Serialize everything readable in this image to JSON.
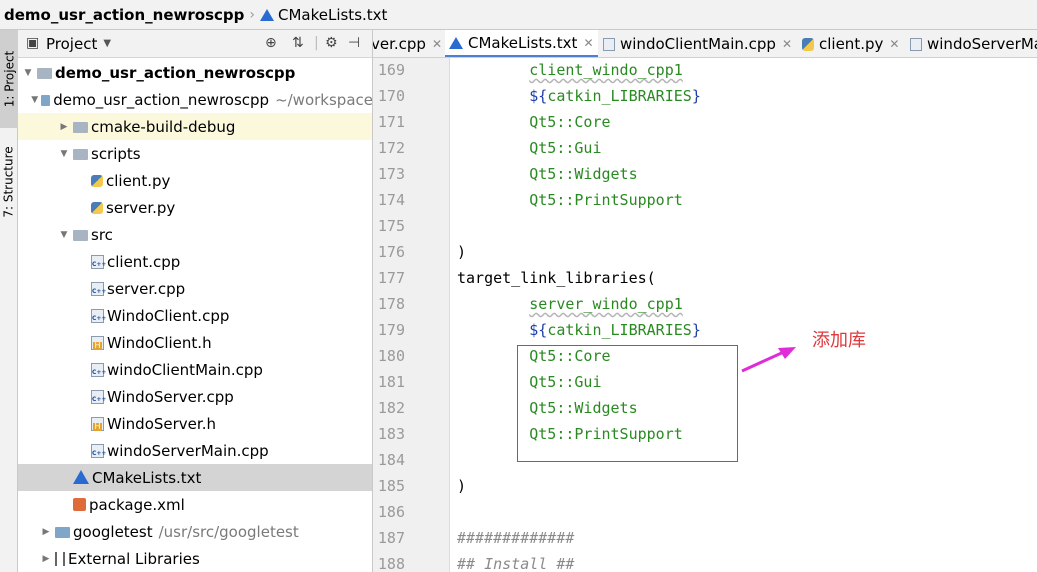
{
  "breadcrumb": {
    "project": "demo_usr_action_newroscpp",
    "file": "CMakeLists.txt"
  },
  "toolstrip": {
    "project_tab": "1: Project",
    "structure_tab": "7: Structure"
  },
  "project_panel": {
    "title": "Project",
    "tree": [
      {
        "label": "demo_usr_action_newroscpp",
        "bold": true,
        "depth": 0,
        "expanded": true,
        "icon": "folder-icon",
        "highlight": ""
      },
      {
        "label": "demo_usr_action_newroscpp",
        "path": "~/workspace",
        "depth": 1,
        "expanded": true,
        "icon": "module-folder-icon",
        "highlight": ""
      },
      {
        "label": "cmake-build-debug",
        "depth": 2,
        "expanded": false,
        "icon": "folder-icon",
        "highlight": "yellow"
      },
      {
        "label": "scripts",
        "depth": 2,
        "expanded": true,
        "icon": "folder-icon",
        "highlight": ""
      },
      {
        "label": "client.py",
        "depth": 3,
        "icon": "python-file-icon",
        "highlight": ""
      },
      {
        "label": "server.py",
        "depth": 3,
        "icon": "python-file-icon",
        "highlight": ""
      },
      {
        "label": "src",
        "depth": 2,
        "expanded": true,
        "icon": "folder-icon",
        "highlight": ""
      },
      {
        "label": "client.cpp",
        "depth": 3,
        "icon": "cpp-file-icon",
        "highlight": ""
      },
      {
        "label": "server.cpp",
        "depth": 3,
        "icon": "cpp-file-icon",
        "highlight": ""
      },
      {
        "label": "WindoClient.cpp",
        "depth": 3,
        "icon": "cpp-file-icon",
        "highlight": ""
      },
      {
        "label": "WindoClient.h",
        "depth": 3,
        "icon": "header-file-icon",
        "highlight": ""
      },
      {
        "label": "windoClientMain.cpp",
        "depth": 3,
        "icon": "cpp-file-icon",
        "highlight": ""
      },
      {
        "label": "WindoServer.cpp",
        "depth": 3,
        "icon": "cpp-file-icon",
        "highlight": ""
      },
      {
        "label": "WindoServer.h",
        "depth": 3,
        "icon": "header-file-icon",
        "highlight": ""
      },
      {
        "label": "windoServerMain.cpp",
        "depth": 3,
        "icon": "cpp-file-icon",
        "highlight": ""
      },
      {
        "label": "CMakeLists.txt",
        "depth": 2,
        "icon": "cmake-file-icon",
        "highlight": "grey"
      },
      {
        "label": "package.xml",
        "depth": 2,
        "icon": "xml-file-icon",
        "highlight": ""
      },
      {
        "label": "googletest",
        "path": "/usr/src/googletest",
        "depth": 1,
        "expanded": false,
        "icon": "module-folder-icon",
        "highlight": ""
      },
      {
        "label": "External Libraries",
        "depth": 1,
        "expanded": false,
        "icon": "library-icon",
        "highlight": ""
      }
    ]
  },
  "tabs": [
    {
      "label": "ver.cpp",
      "icon": "",
      "active": false,
      "closable": true
    },
    {
      "label": "CMakeLists.txt",
      "icon": "cmake",
      "active": true,
      "closable": true
    },
    {
      "label": "windoClientMain.cpp",
      "icon": "cpp",
      "active": false,
      "closable": true
    },
    {
      "label": "client.py",
      "icon": "py",
      "active": false,
      "closable": true
    },
    {
      "label": "windoServerMa",
      "icon": "cpp",
      "active": false,
      "closable": false
    }
  ],
  "editor": {
    "lines": [
      {
        "no": "169",
        "text": "        client_windo_cpp1",
        "style": "green-underline"
      },
      {
        "no": "170",
        "text": "        ${catkin_LIBRARIES}",
        "style": "var"
      },
      {
        "no": "171",
        "text": "        Qt5::Core",
        "style": "green"
      },
      {
        "no": "172",
        "text": "        Qt5::Gui",
        "style": "green"
      },
      {
        "no": "173",
        "text": "        Qt5::Widgets",
        "style": "green"
      },
      {
        "no": "174",
        "text": "        Qt5::PrintSupport",
        "style": "green"
      },
      {
        "no": "175",
        "text": "",
        "style": "plain"
      },
      {
        "no": "176",
        "text": ")",
        "style": "plain"
      },
      {
        "no": "177",
        "text": "target_link_libraries(",
        "style": "plain"
      },
      {
        "no": "178",
        "text": "        server_windo_cpp1",
        "style": "green-underline"
      },
      {
        "no": "179",
        "text": "        ${catkin_LIBRARIES}",
        "style": "var"
      },
      {
        "no": "180",
        "text": "        Qt5::Core",
        "style": "green"
      },
      {
        "no": "181",
        "text": "        Qt5::Gui",
        "style": "green"
      },
      {
        "no": "182",
        "text": "        Qt5::Widgets",
        "style": "green"
      },
      {
        "no": "183",
        "text": "        Qt5::PrintSupport",
        "style": "green"
      },
      {
        "no": "184",
        "text": "",
        "style": "plain"
      },
      {
        "no": "185",
        "text": ")",
        "style": "plain"
      },
      {
        "no": "186",
        "text": "",
        "style": "plain"
      },
      {
        "no": "187",
        "text": "#############",
        "style": "comment"
      },
      {
        "no": "188",
        "text": "## Install ##",
        "style": "comment"
      }
    ]
  },
  "annotation": {
    "label": "添加库",
    "color": "#e0373a",
    "arrow_color": "#e02bd8"
  }
}
